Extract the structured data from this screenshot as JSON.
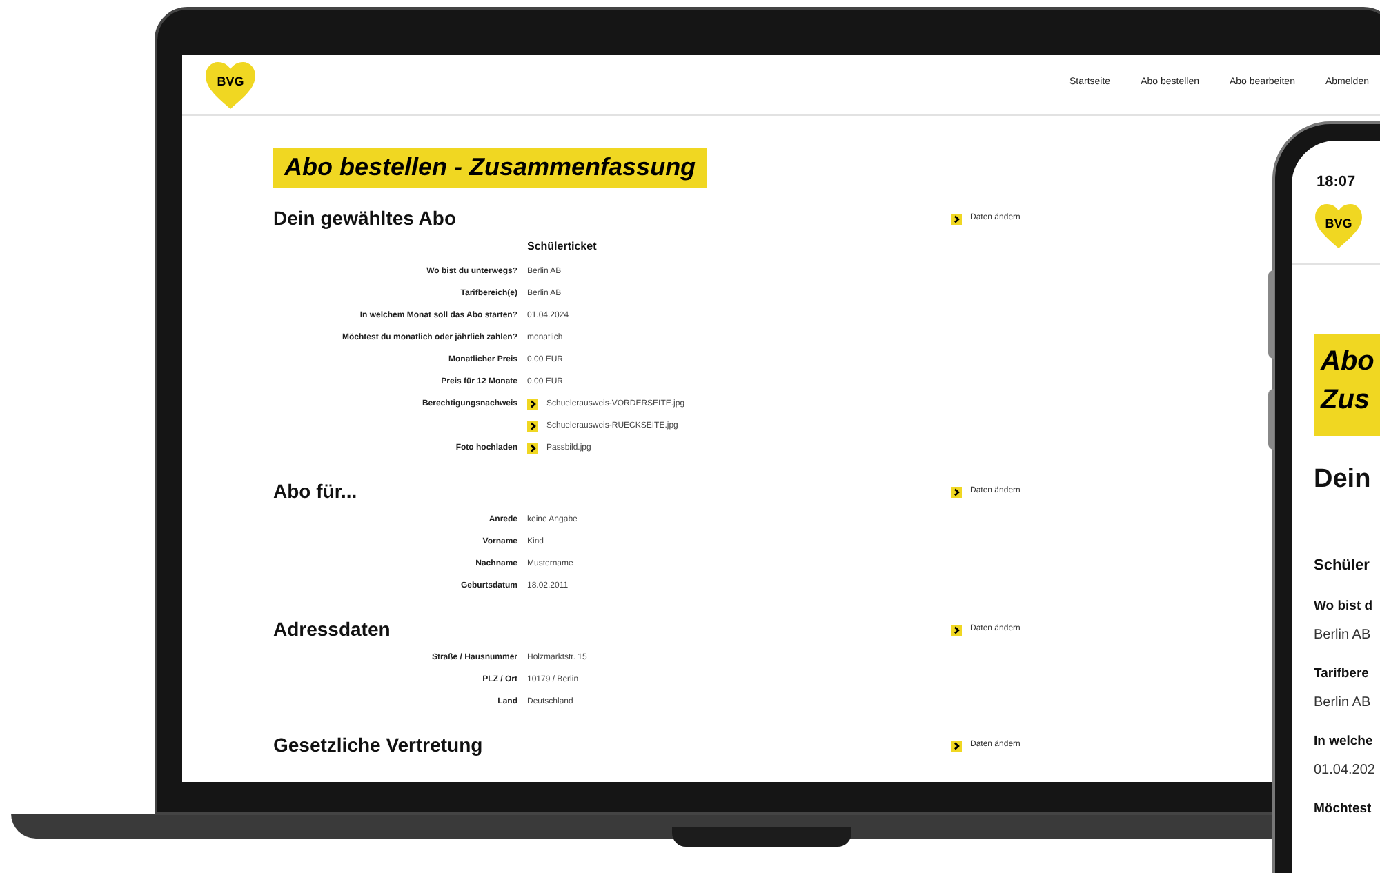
{
  "laptop": {
    "logo": "BVG",
    "nav": [
      "Startseite",
      "Abo bestellen",
      "Abo bearbeiten",
      "Abmelden"
    ],
    "page_title": "Abo bestellen - Zusammenfassung",
    "sections": [
      {
        "heading": "Dein gewähltes Abo",
        "link": "Daten ändern",
        "subtitle": "Schülerticket",
        "rows": [
          {
            "label": "Wo bist du unterwegs?",
            "values": [
              {
                "kind": "text",
                "text": "Berlin AB"
              }
            ]
          },
          {
            "label": "Tarifbereich(e)",
            "values": [
              {
                "kind": "text",
                "text": "Berlin AB"
              }
            ]
          },
          {
            "label": "In welchem Monat soll das Abo starten?",
            "values": [
              {
                "kind": "text",
                "text": "01.04.2024"
              }
            ]
          },
          {
            "label": "Möchtest du monatlich oder jährlich zahlen?",
            "values": [
              {
                "kind": "text",
                "text": "monatlich"
              }
            ]
          },
          {
            "label": "Monatlicher Preis",
            "values": [
              {
                "kind": "text",
                "text": "0,00 EUR"
              }
            ]
          },
          {
            "label": "Preis für 12 Monate",
            "values": [
              {
                "kind": "text",
                "text": "0,00 EUR"
              }
            ]
          },
          {
            "label": "Berechtigungsnachweis",
            "values": [
              {
                "kind": "file",
                "text": "Schuelerausweis-VORDERSEITE.jpg"
              },
              {
                "kind": "file",
                "text": "Schuelerausweis-RUECKSEITE.jpg"
              }
            ]
          },
          {
            "label": "Foto hochladen",
            "values": [
              {
                "kind": "file",
                "text": "Passbild.jpg"
              }
            ]
          }
        ]
      },
      {
        "heading": "Abo für...",
        "link": "Daten ändern",
        "rows": [
          {
            "label": "Anrede",
            "values": [
              {
                "kind": "text",
                "text": "keine Angabe"
              }
            ]
          },
          {
            "label": "Vorname",
            "values": [
              {
                "kind": "text",
                "text": "Kind"
              }
            ]
          },
          {
            "label": "Nachname",
            "values": [
              {
                "kind": "text",
                "text": "Mustername"
              }
            ]
          },
          {
            "label": "Geburtsdatum",
            "values": [
              {
                "kind": "text",
                "text": "18.02.2011"
              }
            ]
          }
        ]
      },
      {
        "heading": "Adressdaten",
        "link": "Daten ändern",
        "rows": [
          {
            "label": "Straße / Hausnummer",
            "values": [
              {
                "kind": "text",
                "text": "Holzmarktstr. 15"
              }
            ]
          },
          {
            "label": "PLZ / Ort",
            "values": [
              {
                "kind": "text",
                "text": "10179 / Berlin"
              }
            ]
          },
          {
            "label": "Land",
            "values": [
              {
                "kind": "text",
                "text": "Deutschland"
              }
            ]
          }
        ]
      },
      {
        "heading": "Gesetzliche Vertretung",
        "link": "Daten ändern"
      }
    ]
  },
  "phone": {
    "time": "18:07",
    "logo": "BVG",
    "title_lines": [
      "Abo",
      "Zus"
    ],
    "heading": "Dein",
    "subtitle": "Schüler",
    "fields": [
      {
        "label": "Wo bist d",
        "value": "Berlin AB"
      },
      {
        "label": "Tarifbere",
        "value": "Berlin AB"
      },
      {
        "label": "In welche",
        "value": "01.04.202"
      },
      {
        "label": "Möchtest"
      }
    ]
  }
}
